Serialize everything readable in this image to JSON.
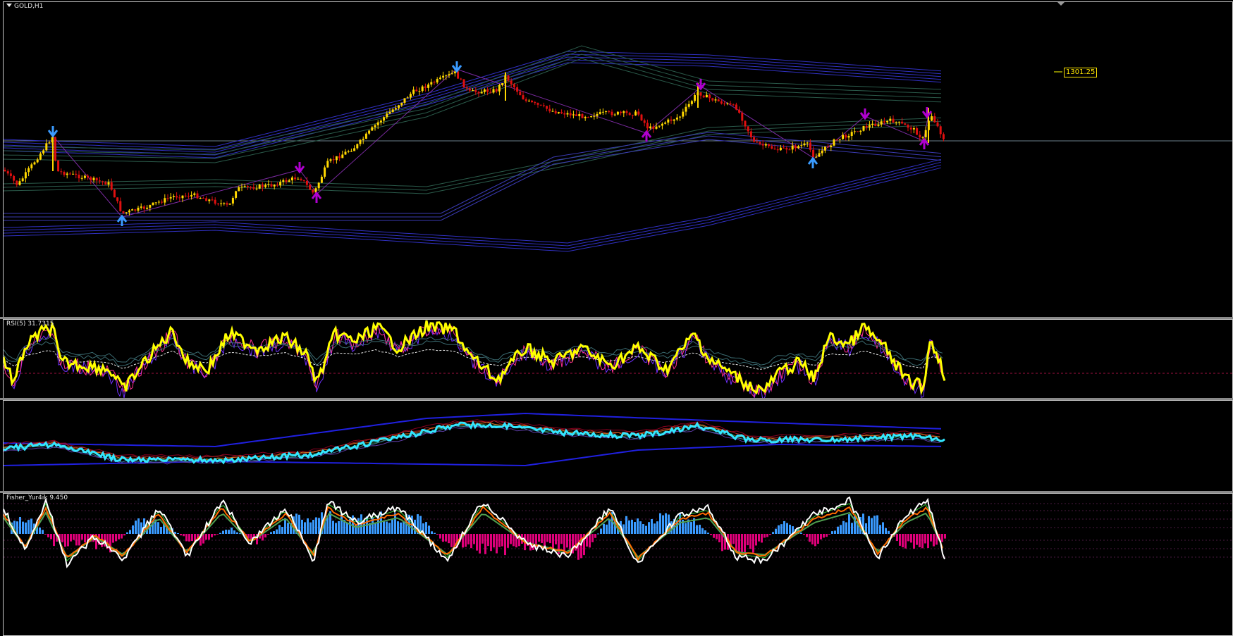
{
  "window": {
    "symbol_label": "GOLD,H1"
  },
  "main_chart": {
    "last_price_label": "1301.25"
  },
  "rsi_pane": {
    "label": "RSI(5) 31.7315"
  },
  "fisher_pane": {
    "label": "Fisher_Yur4ik 9.450"
  },
  "colors": {
    "bull_candle": "#ffd700",
    "bear_candle": "#e01010",
    "rsi_line": "#ffff00",
    "ma_cyan": "#33e6ff",
    "hist_pos": "#3a9bff",
    "hist_neg": "#e0007a",
    "fisher_white": "#ffffff",
    "fisher_orange": "#ff6a00",
    "fisher_green": "#33cc33",
    "arrow_blue": "#3a9bff",
    "arrow_purple": "#b000d0",
    "band_blue": "#3030c0",
    "band_green": "#2a5a4a"
  },
  "chart_data": [
    {
      "type": "line",
      "title": "GOLD,H1",
      "price_label": "1301.25"
    },
    {
      "type": "line",
      "title": "RSI(5) 31.7315",
      "last_value": 31.7315
    },
    {
      "type": "line",
      "title": ""
    },
    {
      "type": "line",
      "title": "Fisher_Yur4ik 9.450",
      "last_value": 9.45
    }
  ]
}
